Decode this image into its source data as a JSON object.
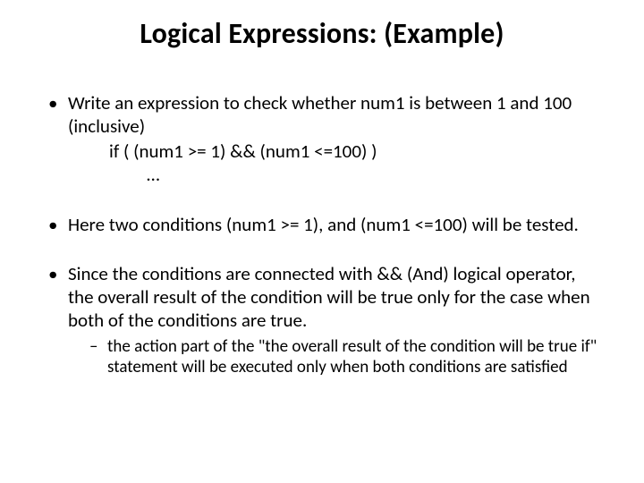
{
  "title": "Logical Expressions: (Example)",
  "bullets": [
    {
      "text": "Write an expression to check whether num1  is between 1 and 100 (inclusive)",
      "code": {
        "line1": "if ( (num1 >= 1) && (num1 <=100) )",
        "line2": "…"
      }
    },
    {
      "text": "Here two conditions (num1 >= 1), and (num1 <=100) will be tested."
    },
    {
      "text": "Since the conditions are connected with && (And) logical operator, the overall result of the condition will be true only for the case when both of the conditions are true.",
      "sub": [
        "the action part of the \"the overall result of the condition will be true if\" statement  will be executed only when both conditions are satisfied"
      ]
    }
  ]
}
